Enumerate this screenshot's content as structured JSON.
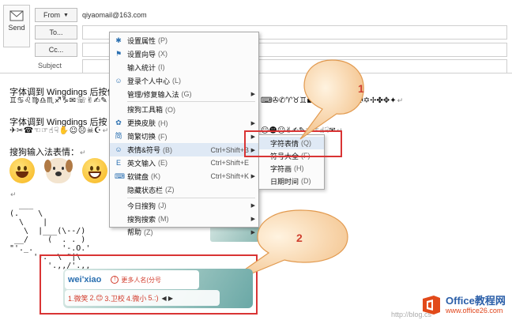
{
  "compose": {
    "send_label": "Send",
    "from_label": "From",
    "from_value": "qiyaomail@163.com",
    "to_label": "To...",
    "cc_label": "Cc...",
    "subject_label": "Subject"
  },
  "body": {
    "line1": "字体调到 Wingdings 后按住",
    "wing1": "♊♋♌♍♎♏♐♑✉☏✌✍✎",
    "line2": "字体调到 Wingdings 后按 SI",
    "wing2": "✈✂☎☜☞☝☟✋☺☹☠☪",
    "line3": "搜狗输入法表情：",
    "right_wing1": "⌨✇✆♈♉♊▪❖✚✪✦✸⬥⬦✠✡✢✤✥✦",
    "right_wing2": "☺☻☹✌✍✎☜☞☝☟✉",
    "return_mark": "↵",
    "ascii": [
      "  ___",
      "(.    \\",
      "  \\    |",
      "   \\  |___(\\--/)",
      " __/    (  . . )",
      "\"'._.      '-.O.'",
      "     '-.  \\ \"|\\",
      "        '.,,/'.,,"
    ]
  },
  "menu": {
    "items": [
      {
        "icon": "✱",
        "label": "设置属性",
        "key": "(P)",
        "accel": "",
        "arrow": false
      },
      {
        "icon": "⚑",
        "label": "设置向导",
        "key": "(X)",
        "accel": "",
        "arrow": false
      },
      {
        "icon": "",
        "label": "输入统计",
        "key": "(I)",
        "accel": "",
        "arrow": false
      },
      {
        "icon": "☺",
        "label": "登录个人中心",
        "key": "(L)",
        "accel": "",
        "arrow": false
      },
      {
        "icon": "",
        "label": "管理/修复输入法",
        "key": "(G)",
        "accel": "",
        "arrow": true
      },
      {
        "sep": true
      },
      {
        "icon": "",
        "label": "搜狗工具箱",
        "key": "(O)",
        "accel": "",
        "arrow": false
      },
      {
        "icon": "✿",
        "label": "更换皮肤",
        "key": "(H)",
        "accel": "",
        "arrow": true
      },
      {
        "icon": "简",
        "label": "简繁切换",
        "key": "(F)",
        "accel": "",
        "arrow": true
      },
      {
        "icon": "☺",
        "label": "表情&符号",
        "key": "(B)",
        "accel": "Ctrl+Shift+B",
        "arrow": true,
        "highlight": true
      },
      {
        "icon": "E",
        "label": "英文输入",
        "key": "(E)",
        "accel": "Ctrl+Shift+E",
        "arrow": false
      },
      {
        "icon": "⌨",
        "label": "软键盘",
        "key": "(K)",
        "accel": "Ctrl+Shift+K",
        "arrow": true
      },
      {
        "icon": "",
        "label": "隐藏状态栏",
        "key": "(Z)",
        "accel": "",
        "arrow": false
      },
      {
        "sep": true
      },
      {
        "icon": "",
        "label": "今日搜狗",
        "key": "(J)",
        "accel": "",
        "arrow": true
      },
      {
        "icon": "",
        "label": "搜狗搜索",
        "key": "(M)",
        "accel": "",
        "arrow": true
      },
      {
        "icon": "",
        "label": "帮助",
        "key": "(Z)",
        "accel": "",
        "arrow": true
      }
    ]
  },
  "submenu": {
    "items": [
      {
        "label": "字符表情",
        "key": "(Q)",
        "highlight": true
      },
      {
        "label": "符号大全",
        "key": "(F)"
      },
      {
        "label": "字符画",
        "key": "(H)"
      },
      {
        "label": "日期时间",
        "key": "(D)"
      }
    ]
  },
  "callouts": {
    "one": "1",
    "two": "2"
  },
  "ime": {
    "pinyin": "wei'xiao",
    "tip_icon": "!",
    "tip": "更多人名(分号",
    "candidates": [
      "1.微笑",
      "2.😊",
      "3.卫校",
      "4.微小",
      "5.:)"
    ],
    "nav": "◀ ▶"
  },
  "watermark": {
    "title": "Office教程网",
    "url": "www.office26.com",
    "grey": "http://blog.cs"
  },
  "colors": {
    "accent_red": "#d93434",
    "callout_orange": "#f0b070",
    "menu_highlight": "#dfe9f5"
  }
}
